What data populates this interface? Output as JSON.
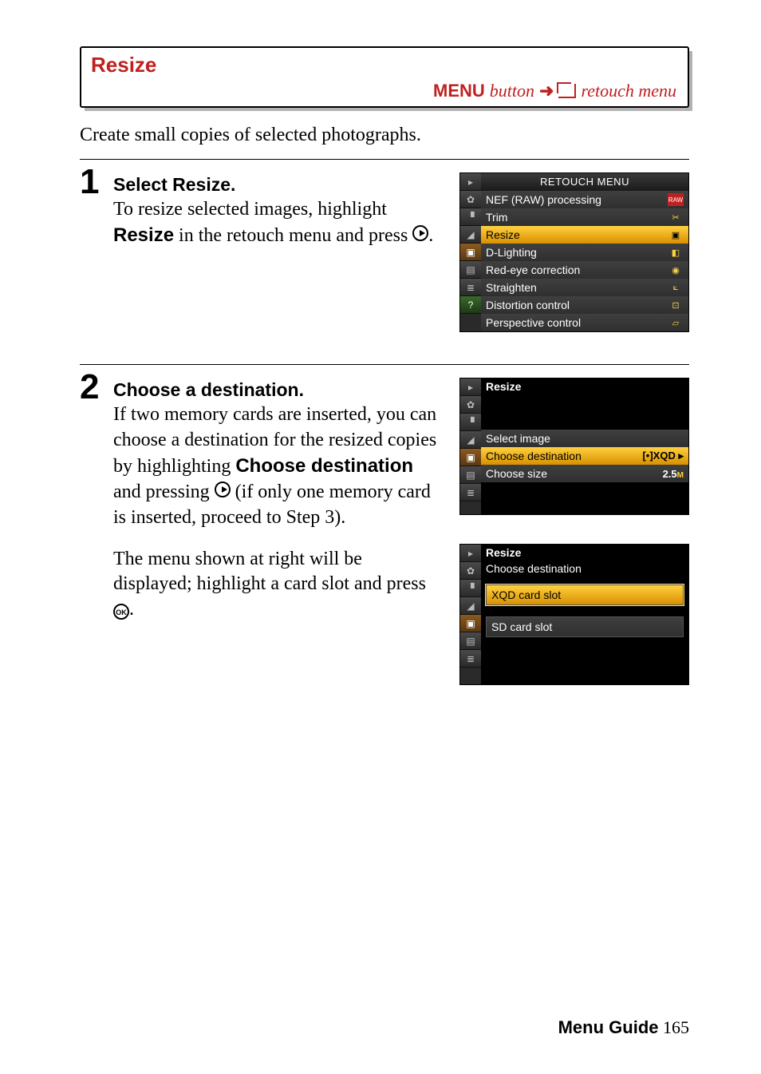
{
  "heading": "Resize",
  "menuPath": {
    "menu": "MENU",
    "button": " button",
    "retouch": " retouch menu"
  },
  "intro": "Create small copies of selected photographs.",
  "step1": {
    "title": "Select Resize.",
    "line1a": "To resize selected images, highlight ",
    "bold": "Resize",
    "line1b": " in the retouch menu and press ",
    "dot": "."
  },
  "step2": {
    "title": "Choose a destination.",
    "p1a": "If two memory cards are inserted, you can choose a destination for the resized copies by highlighting ",
    "bold": "Choose destination",
    "p1b": " and pressing ",
    "p1c": " (if only one memory card is inserted, proceed to Step 3).",
    "p2a": "The menu shown at right will be displayed; highlight a card slot and press ",
    "p2dot": "."
  },
  "shot_retouch": {
    "title": "RETOUCH MENU",
    "items": [
      {
        "label": "NEF (RAW) processing",
        "icon": "RAW"
      },
      {
        "label": "Trim",
        "icon": "✂"
      },
      {
        "label": "Resize",
        "icon": "▣",
        "hl": true
      },
      {
        "label": "D-Lighting",
        "icon": "◧"
      },
      {
        "label": "Red-eye correction",
        "icon": "◉"
      },
      {
        "label": "Straighten",
        "icon": "⟀"
      },
      {
        "label": "Distortion control",
        "icon": "⊡"
      },
      {
        "label": "Perspective control",
        "icon": "▱"
      }
    ]
  },
  "shot_resize": {
    "title": "Resize",
    "rows": [
      {
        "label": "Select image",
        "value": ""
      },
      {
        "label": "Choose destination",
        "value": "[•]XQD ▸",
        "hl": true
      },
      {
        "label": "Choose size",
        "value": "2.5M"
      }
    ]
  },
  "shot_dest": {
    "title": "Resize",
    "subtitle": "Choose destination",
    "items": [
      {
        "label": "XQD card slot",
        "hl": true
      },
      {
        "label": "SD card slot"
      }
    ]
  },
  "footer": {
    "label": "Menu Guide",
    "page": " 165"
  },
  "ok_glyph": "OK"
}
